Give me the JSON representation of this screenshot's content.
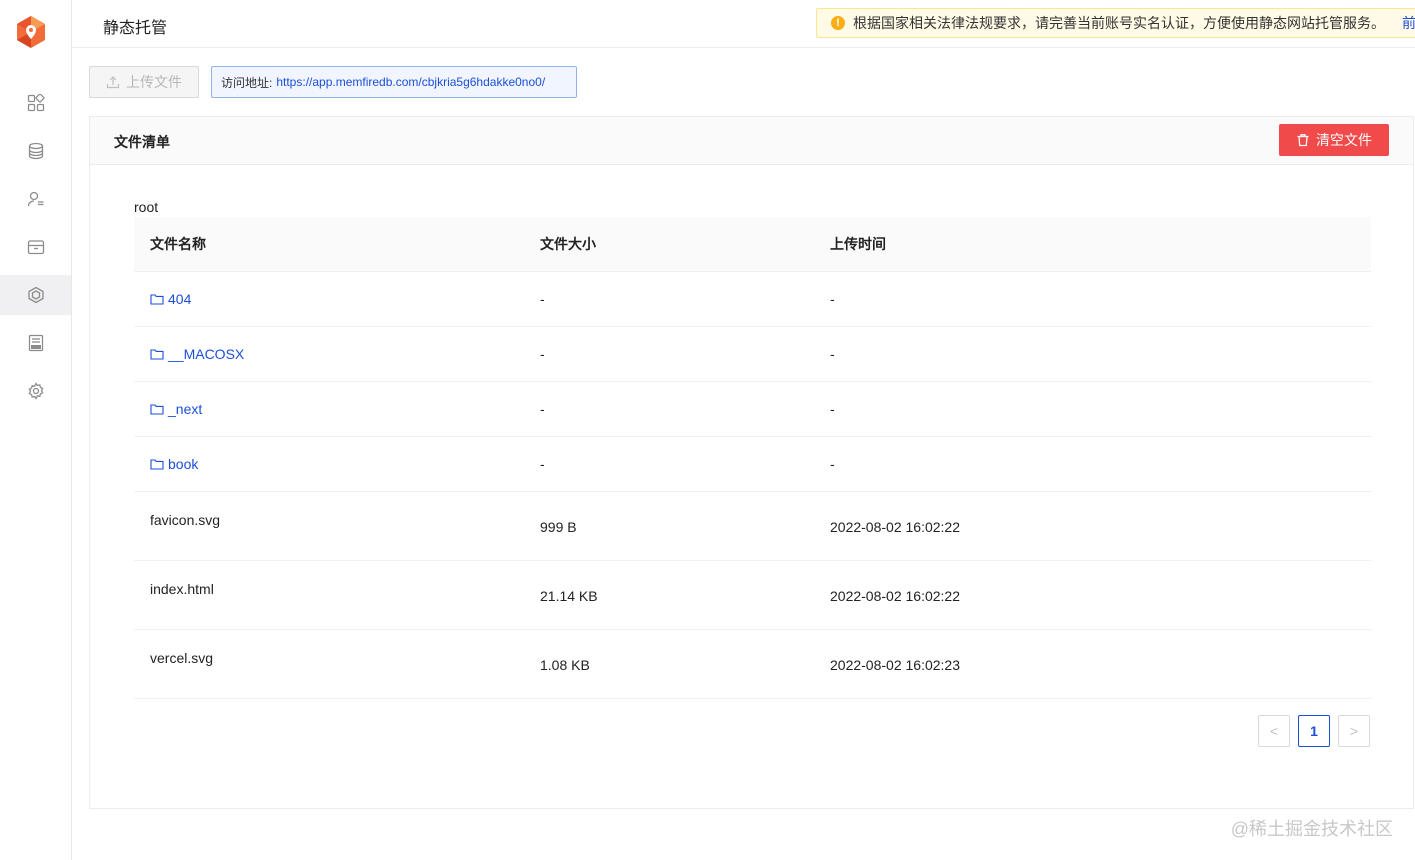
{
  "header": {
    "page_title": "静态托管",
    "notice": {
      "text": "根据国家相关法律法规要求，请完善当前账号实名认证，方便使用静态网站托管服务。",
      "link": "前往认证"
    }
  },
  "sidebar": {
    "items": [
      {
        "name": "dashboard",
        "icon": "grid-icon"
      },
      {
        "name": "database",
        "icon": "database-icon"
      },
      {
        "name": "users",
        "icon": "user-list-icon"
      },
      {
        "name": "storage",
        "icon": "box-icon"
      },
      {
        "name": "hosting",
        "icon": "cube-icon",
        "active": true
      },
      {
        "name": "api",
        "icon": "api-doc-icon"
      },
      {
        "name": "settings",
        "icon": "gear-icon"
      }
    ]
  },
  "toolbar": {
    "upload_label": "上传文件",
    "url_prefix": "访问地址:",
    "url": "https://app.memfiredb.com/cbjkria5g6hdakke0no0/"
  },
  "file_list": {
    "title": "文件清单",
    "clear_label": "清空文件",
    "path": "root",
    "columns": [
      "文件名称",
      "文件大小",
      "上传时间"
    ],
    "folders": [
      {
        "name": "404",
        "size": "-",
        "time": "-"
      },
      {
        "name": "__MACOSX",
        "size": "-",
        "time": "-"
      },
      {
        "name": "_next",
        "size": "-",
        "time": "-"
      },
      {
        "name": "book",
        "size": "-",
        "time": "-"
      }
    ],
    "files": [
      {
        "name": "favicon.svg",
        "size": "999 B",
        "time": "2022-08-02 16:02:22"
      },
      {
        "name": "index.html",
        "size": "21.14 KB",
        "time": "2022-08-02 16:02:22"
      },
      {
        "name": "vercel.svg",
        "size": "1.08 KB",
        "time": "2022-08-02 16:02:23"
      }
    ]
  },
  "pagination": {
    "prev": "<",
    "current": "1",
    "next": ">"
  },
  "watermark": "@稀土掘金技术社区",
  "colors": {
    "accent": "#1d4ed8",
    "danger": "#f04a4a",
    "warning": "#faad14",
    "brand": "#f26b3a"
  }
}
